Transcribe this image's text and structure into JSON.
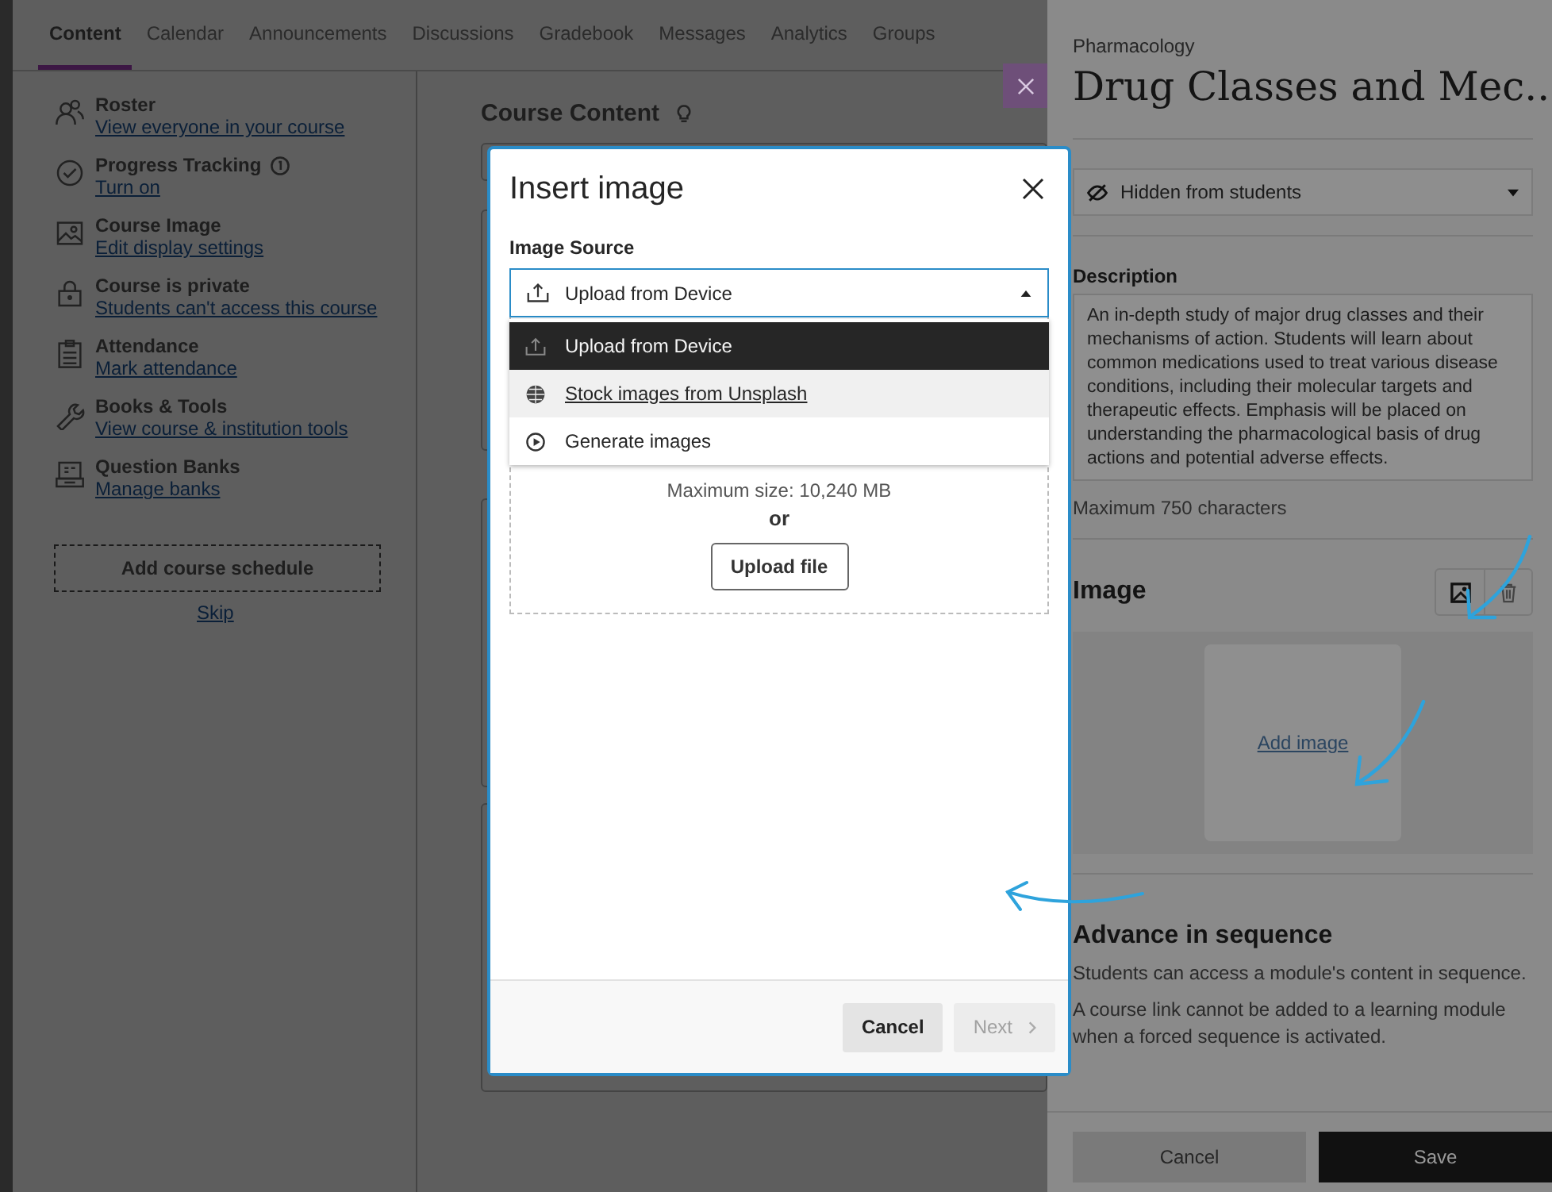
{
  "tabs": [
    {
      "label": "Content",
      "selected": true
    },
    {
      "label": "Calendar",
      "selected": false
    },
    {
      "label": "Announcements",
      "selected": false
    },
    {
      "label": "Discussions",
      "selected": false
    },
    {
      "label": "Gradebook",
      "selected": false
    },
    {
      "label": "Messages",
      "selected": false
    },
    {
      "label": "Analytics",
      "selected": false
    },
    {
      "label": "Groups",
      "selected": false
    }
  ],
  "sidebar": {
    "items": [
      {
        "title": "Roster",
        "link": "View everyone in your course",
        "info": false
      },
      {
        "title": "Progress Tracking",
        "link": "Turn on",
        "info": true
      },
      {
        "title": "Course Image",
        "link": "Edit display settings",
        "info": false
      },
      {
        "title": "Course is private",
        "link": "Students can't access this course",
        "info": false
      },
      {
        "title": "Attendance",
        "link": "Mark attendance",
        "info": false
      },
      {
        "title": "Books & Tools",
        "link": "View course & institution tools",
        "info": false
      },
      {
        "title": "Question Banks",
        "link": "Manage banks",
        "info": false
      }
    ],
    "schedule_button": "Add course schedule",
    "skip_link": "Skip"
  },
  "content": {
    "title": "Course Content"
  },
  "modal": {
    "title": "Insert image",
    "source_label": "Image Source",
    "select_value": "Upload from Device",
    "expanded": true,
    "options": [
      {
        "label": "Upload from Device",
        "selected": true,
        "highlighted": false
      },
      {
        "label": "Stock images from Unsplash",
        "selected": false,
        "highlighted": true
      },
      {
        "label": "Generate images",
        "selected": false,
        "highlighted": false
      }
    ],
    "max_size": "Maximum size: 10,240 MB",
    "or": "or",
    "upload_button": "Upload file",
    "cancel": "Cancel",
    "next": "Next",
    "next_disabled": true
  },
  "panel": {
    "eyebrow": "Pharmacology",
    "title": "Drug Classes and Mec...",
    "visibility": "Hidden from students",
    "description_label": "Description",
    "description": "An in-depth study of major drug classes and their mechanisms of action. Students will learn about common medications used to treat various disease conditions, including their molecular targets and therapeutic effects. Emphasis will be placed on understanding the pharmacological basis of drug actions and potential adverse effects.",
    "hint": "Maximum 750 characters",
    "image_label": "Image",
    "add_image": "Add image",
    "advance_title": "Advance in sequence",
    "advance_text": "Students can access a module's content in sequence.",
    "advance_note": "A course link cannot be added to a learning module when a forced sequence is activated.",
    "cancel": "Cancel",
    "save": "Save"
  }
}
